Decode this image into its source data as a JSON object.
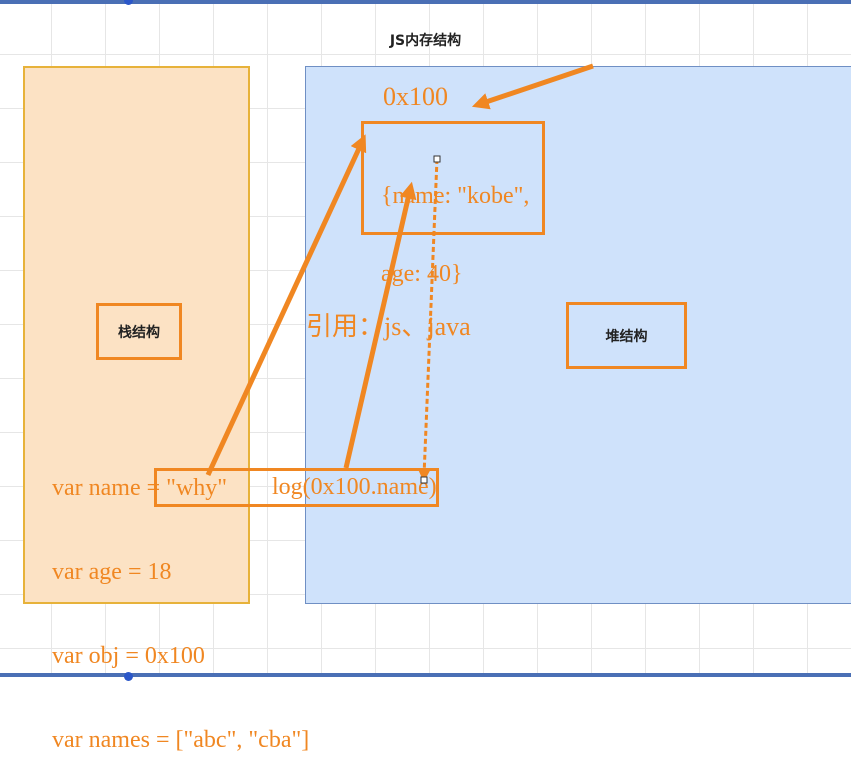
{
  "title": "JS内存结构",
  "stack": {
    "label": "栈结构",
    "code_lines": [
      "var name = \"why\"",
      "var age = 18",
      "var obj = 0x100",
      "var names = [\"abc\", \"cba\"]"
    ]
  },
  "heap": {
    "label": "堆结构",
    "address": "0x100",
    "object_line1": "{name: \"kobe\",",
    "object_line2": "age: 40}"
  },
  "annotations": {
    "reference_note": "引用：js、java",
    "log_call": "log(0x100.name)"
  },
  "colors": {
    "accent": "#f08722",
    "stack_fill": "#fce2c4",
    "stack_border": "#e7b23a",
    "heap_fill": "#cfe2fb",
    "heap_border": "#6f8fc4"
  }
}
